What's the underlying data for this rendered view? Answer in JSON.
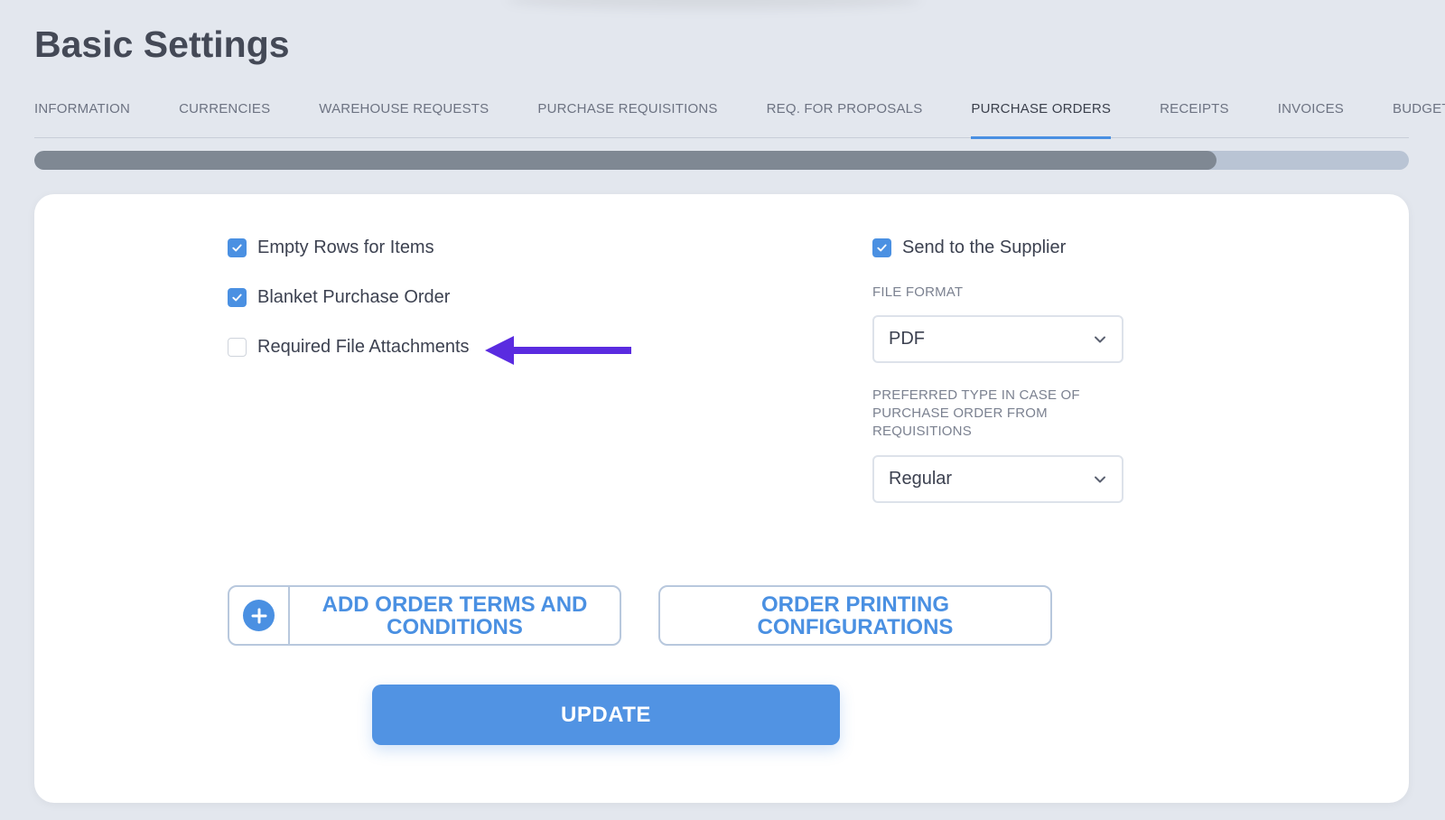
{
  "page": {
    "title": "Basic Settings"
  },
  "tabs": [
    {
      "label": "INFORMATION",
      "active": false
    },
    {
      "label": "CURRENCIES",
      "active": false
    },
    {
      "label": "WAREHOUSE REQUESTS",
      "active": false
    },
    {
      "label": "PURCHASE REQUISITIONS",
      "active": false
    },
    {
      "label": "REQ. FOR PROPOSALS",
      "active": false
    },
    {
      "label": "PURCHASE ORDERS",
      "active": true
    },
    {
      "label": "RECEIPTS",
      "active": false
    },
    {
      "label": "INVOICES",
      "active": false
    },
    {
      "label": "BUDGETS",
      "active": false
    }
  ],
  "scroll_progress": 0.86,
  "left_options": [
    {
      "label": "Empty Rows for Items",
      "checked": true
    },
    {
      "label": "Blanket Purchase Order",
      "checked": true
    },
    {
      "label": "Required File Attachments",
      "checked": false
    }
  ],
  "right_options": {
    "send_to_supplier": {
      "label": "Send to the Supplier",
      "checked": true
    },
    "file_format": {
      "label": "FILE FORMAT",
      "value": "PDF"
    },
    "preferred_type": {
      "label_lines": [
        "PREFERRED TYPE IN CASE OF",
        "PURCHASE ORDER FROM",
        "REQUISITIONS"
      ],
      "value": "Regular"
    }
  },
  "buttons": {
    "add_terms_line1": "ADD ORDER TERMS AND",
    "add_terms_line2": "CONDITIONS",
    "printing_line1": "ORDER PRINTING",
    "printing_line2": "CONFIGURATIONS",
    "update": "UPDATE"
  },
  "annotation": {
    "arrow_color": "#5a2be0",
    "icon": "arrow-left-icon"
  },
  "colors": {
    "accent": "#4a90e2",
    "background": "#e3e7ee",
    "card": "#ffffff"
  }
}
